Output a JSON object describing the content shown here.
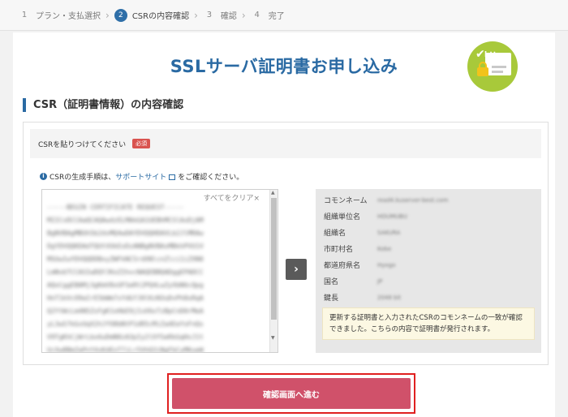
{
  "stepper": {
    "steps": [
      {
        "num": "1",
        "label": "プラン・支払選択"
      },
      {
        "num": "2",
        "label": "CSRの内容確認"
      },
      {
        "num": "3",
        "label": "確認"
      },
      {
        "num": "4",
        "label": "完了"
      }
    ],
    "active_index": 1
  },
  "header": {
    "title": "SSLサーバ証明書お申し込み",
    "badge_text": "https"
  },
  "section": {
    "heading": "CSR（証明書情報）の内容確認"
  },
  "csr_card": {
    "label": "CSRを貼りつけてください",
    "required_badge": "必須",
    "info_prefix": "CSRの生成手順は、",
    "info_link": "サポートサイト",
    "info_suffix": "をご確認ください。",
    "clear_label": "すべてをクリア×",
    "csr_text": "-----BEGIN CERTIFICATE REQUEST-----\nMIICvDCCAaQCAQAwdzELMAkGA1UEBhMCSlAxDjAM\nBgNVBAgMBUh5b2dvMQ4wDAYDVQQHDAVLb2JlMRAw\nDgYDVQQKDAdTQUtVUkExDzANBgNVBAsMBkhPVU1V\nMSUwIwYDVQQDDBxyZWFkNC5rdXNlcnZlci1iZXN0\nLmNvbTCCASIwDQYJKoZIhvcNAQEBBQADggEPADCC\nAQoCggEBAMj3gKmV8xUFSeRt2PQ4LwZyXbN6cQpg\nHnT1kVcO9aIrE5bWm7sYdGfJ0lKzN3uDvPh8xRqA\nQ2YtWcLm4N5ZsFgK1oHbE9jIuV6xTzBpCnD0rMeA\nyL3wS7kGvUqX2hJfO8bNtP1dR5cMiZa4EeYoFnQs\nV9TgKhCjWrLbx6uDmN0zA3pIy2lOfSeRkGqHvJ1t\nUcXw8BmZaPnY4sKdEoT7jLr5VhQ3iNgFbCyM6ueW\n-----END CERTIFICATE REQUEST-----",
    "fields": [
      {
        "key": "コモンネーム",
        "value": "read4.kuserver-best.com"
      },
      {
        "key": "組織単位名",
        "value": "HOUMUBU"
      },
      {
        "key": "組織名",
        "value": "SAKURA"
      },
      {
        "key": "市町村名",
        "value": "Kobe"
      },
      {
        "key": "都道府県名",
        "value": "Hyogo"
      },
      {
        "key": "国名",
        "value": "JP"
      },
      {
        "key": "鍵長",
        "value": "2048 bit"
      }
    ],
    "notice": "更新する証明書と入力されたCSRのコモンネームの一致が確認できました。こちらの内容で証明書が発行されます。"
  },
  "actions": {
    "submit_label": "確認画面へ進む"
  },
  "colors": {
    "accent": "#2a6aa3",
    "submit": "#d0516a",
    "badge_green": "#a8c93a",
    "highlight_red": "#e02020"
  }
}
